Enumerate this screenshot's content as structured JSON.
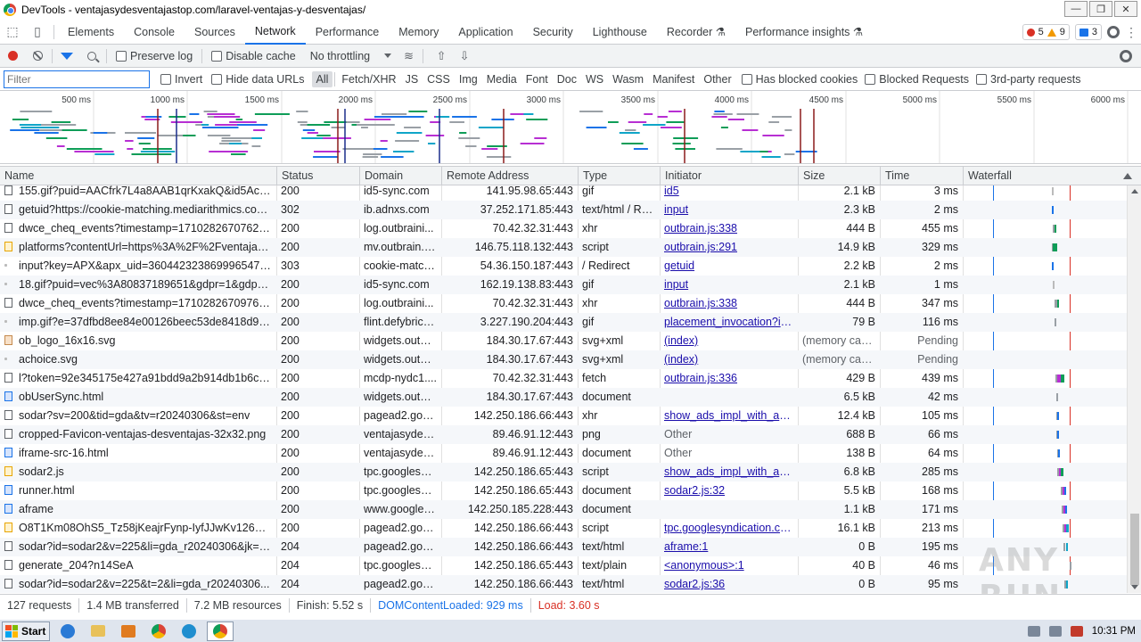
{
  "window": {
    "title": "DevTools - ventajasydesventajastop.com/laravel-ventajas-y-desventajas/",
    "buttons": [
      "—",
      "❐",
      "✕"
    ]
  },
  "devtools": {
    "tabs": [
      "Elements",
      "Console",
      "Sources",
      "Network",
      "Performance",
      "Memory",
      "Application",
      "Security",
      "Lighthouse",
      "Recorder",
      "Performance insights"
    ],
    "active_tab": "Network",
    "errors": "5",
    "warnings": "9",
    "messages": "3"
  },
  "toolbar": {
    "preserve_log": "Preserve log",
    "disable_cache": "Disable cache",
    "throttling": "No throttling"
  },
  "filter": {
    "placeholder": "Filter",
    "invert": "Invert",
    "hide_data_urls": "Hide data URLs",
    "types": [
      "All",
      "Fetch/XHR",
      "JS",
      "CSS",
      "Img",
      "Media",
      "Font",
      "Doc",
      "WS",
      "Wasm",
      "Manifest",
      "Other"
    ],
    "active_type": "All",
    "has_blocked_cookies": "Has blocked cookies",
    "blocked_requests": "Blocked Requests",
    "third_party": "3rd-party requests"
  },
  "overview": {
    "ticks": [
      "500 ms",
      "1000 ms",
      "1500 ms",
      "2000 ms",
      "2500 ms",
      "3000 ms",
      "3500 ms",
      "4000 ms",
      "4500 ms",
      "5000 ms",
      "5500 ms",
      "6000 ms"
    ]
  },
  "table": {
    "columns": [
      "Name",
      "Status",
      "Domain",
      "Remote Address",
      "Type",
      "Initiator",
      "Size",
      "Time",
      "Waterfall"
    ],
    "rows": [
      {
        "icon": "xhr",
        "name": "155.gif?puid=AACfrk7L4a8AAB1qrKxakQ&id5Acco...",
        "status": "200",
        "domain": "id5-sync.com",
        "remote": "141.95.98.65:443",
        "type": "gif",
        "initiator": "id5",
        "initiator_link": true,
        "size": "2.1 kB",
        "time": "3 ms",
        "wf": [
          {
            "s": 0.905,
            "w": 0.004,
            "c": "#bbb"
          }
        ]
      },
      {
        "icon": "xhr",
        "name": "getuid?https://cookie-matching.mediarithmics.com...",
        "status": "302",
        "domain": "ib.adnxs.com",
        "remote": "37.252.171.85:443",
        "type": "text/html / Re...",
        "initiator": "input",
        "initiator_link": true,
        "size": "2.3 kB",
        "time": "2 ms",
        "wf": [
          {
            "s": 0.91,
            "w": 0.006,
            "c": "#1a73e8"
          }
        ]
      },
      {
        "icon": "xhr",
        "name": "dwce_cheq_events?timestamp=1710282670762&s...",
        "status": "200",
        "domain": "log.outbraini...",
        "remote": "70.42.32.31:443",
        "type": "xhr",
        "initiator": "outbrain.js:338",
        "initiator_link": true,
        "size": "444 B",
        "time": "455 ms",
        "wf": [
          {
            "s": 0.915,
            "w": 0.02,
            "c": "#9aa0a6"
          },
          {
            "s": 0.935,
            "w": 0.02,
            "c": "#0f9d58"
          }
        ]
      },
      {
        "icon": "script",
        "name": "platforms?contentUrl=https%3A%2F%2Fventajasy...",
        "status": "200",
        "domain": "mv.outbrain.c...",
        "remote": "146.75.118.132:443",
        "type": "script",
        "initiator": "outbrain.js:291",
        "initiator_link": true,
        "size": "14.9 kB",
        "time": "329 ms",
        "wf": [
          {
            "s": 0.912,
            "w": 0.006,
            "c": "#9aa0a6"
          },
          {
            "s": 0.918,
            "w": 0.045,
            "c": "#0f9d58"
          }
        ]
      },
      {
        "icon": "blank",
        "name": "input?key=APX&apx_uid=3604423238699965471...",
        "status": "303",
        "domain": "cookie-match...",
        "remote": "54.36.150.187:443",
        "type": "/ Redirect",
        "initiator": "getuid",
        "initiator_link": true,
        "size": "2.2 kB",
        "time": "2 ms",
        "wf": [
          {
            "s": 0.913,
            "w": 0.006,
            "c": "#1a73e8"
          }
        ]
      },
      {
        "icon": "blank",
        "name": "18.gif?puid=vec%3A80837189651&gdpr=1&gdpr_...",
        "status": "200",
        "domain": "id5-sync.com",
        "remote": "162.19.138.83:443",
        "type": "gif",
        "initiator": "input",
        "initiator_link": true,
        "size": "2.1 kB",
        "time": "1 ms",
        "wf": [
          {
            "s": 0.915,
            "w": 0.004,
            "c": "#bbb"
          }
        ]
      },
      {
        "icon": "xhr",
        "name": "dwce_cheq_events?timestamp=1710282670976&s...",
        "status": "200",
        "domain": "log.outbraini...",
        "remote": "70.42.32.31:443",
        "type": "xhr",
        "initiator": "outbrain.js:338",
        "initiator_link": true,
        "size": "444 B",
        "time": "347 ms",
        "wf": [
          {
            "s": 0.935,
            "w": 0.03,
            "c": "#9aa0a6"
          },
          {
            "s": 0.965,
            "w": 0.02,
            "c": "#0f9d58"
          }
        ]
      },
      {
        "icon": "blank",
        "name": "imp.gif?e=37dfbd8ee84e00126beec53de8418d9c9...",
        "status": "200",
        "domain": "flint.defybrick...",
        "remote": "3.227.190.204:443",
        "type": "gif",
        "initiator": "placement_invocation?id...",
        "initiator_link": true,
        "size": "79 B",
        "time": "116 ms",
        "wf": [
          {
            "s": 0.935,
            "w": 0.02,
            "c": "#9aa0a6"
          }
        ]
      },
      {
        "icon": "img",
        "name": "ob_logo_16x16.svg",
        "status": "200",
        "domain": "widgets.outbr...",
        "remote": "184.30.17.67:443",
        "type": "svg+xml",
        "initiator": "(index)",
        "initiator_link": true,
        "size": "(memory cac...",
        "time": "Pending",
        "muted": true,
        "wf": []
      },
      {
        "icon": "blank",
        "name": "achoice.svg",
        "status": "200",
        "domain": "widgets.outbr...",
        "remote": "184.30.17.67:443",
        "type": "svg+xml",
        "initiator": "(index)",
        "initiator_link": true,
        "size": "(memory cac...",
        "time": "Pending",
        "muted": true,
        "wf": []
      },
      {
        "icon": "xhr",
        "name": "l?token=92e345175e427a91bdd9a2b914db1b6c_5...",
        "status": "200",
        "domain": "mcdp-nydc1....",
        "remote": "70.42.32.31:443",
        "type": "fetch",
        "initiator": "outbrain.js:336",
        "initiator_link": true,
        "size": "429 B",
        "time": "439 ms",
        "wf": [
          {
            "s": 0.945,
            "w": 0.02,
            "c": "#9aa0a6"
          },
          {
            "s": 0.965,
            "w": 0.035,
            "c": "#b72fd3"
          },
          {
            "s": 1.0,
            "w": 0.04,
            "c": "#0f9d58"
          }
        ]
      },
      {
        "icon": "doc",
        "name": "obUserSync.html",
        "status": "200",
        "domain": "widgets.outbr...",
        "remote": "184.30.17.67:443",
        "type": "document",
        "initiator": "",
        "initiator_link": false,
        "size": "6.5 kB",
        "time": "42 ms",
        "wf": [
          {
            "s": 0.95,
            "w": 0.01,
            "c": "#9aa0a6"
          }
        ]
      },
      {
        "icon": "xhr",
        "name": "sodar?sv=200&tid=gda&tv=r20240306&st=env",
        "status": "200",
        "domain": "pagead2.goo...",
        "remote": "142.250.186.66:443",
        "type": "xhr",
        "initiator": "show_ads_impl_with_ama...",
        "initiator_link": true,
        "size": "12.4 kB",
        "time": "105 ms",
        "wf": [
          {
            "s": 0.955,
            "w": 0.01,
            "c": "#9aa0a6"
          },
          {
            "s": 0.965,
            "w": 0.015,
            "c": "#1a73e8"
          }
        ]
      },
      {
        "icon": "xhr",
        "name": "cropped-Favicon-ventajas-desventajas-32x32.png",
        "status": "200",
        "domain": "ventajasydesv...",
        "remote": "89.46.91.12:443",
        "type": "png",
        "initiator": "Other",
        "initiator_link": false,
        "muted_initiator": true,
        "size": "688 B",
        "time": "66 ms",
        "wf": [
          {
            "s": 0.955,
            "w": 0.01,
            "c": "#9aa0a6"
          },
          {
            "s": 0.965,
            "w": 0.01,
            "c": "#1a73e8"
          }
        ]
      },
      {
        "icon": "doc",
        "name": "iframe-src-16.html",
        "status": "200",
        "domain": "ventajasydesv...",
        "remote": "89.46.91.12:443",
        "type": "document",
        "initiator": "Other",
        "initiator_link": false,
        "muted_initiator": true,
        "size": "138 B",
        "time": "64 ms",
        "wf": [
          {
            "s": 0.96,
            "w": 0.01,
            "c": "#9aa0a6"
          },
          {
            "s": 0.97,
            "w": 0.01,
            "c": "#1a73e8"
          }
        ]
      },
      {
        "icon": "script",
        "name": "sodar2.js",
        "status": "200",
        "domain": "tpc.googlesyn...",
        "remote": "142.250.186.65:443",
        "type": "script",
        "initiator": "show_ads_impl_with_ama...",
        "initiator_link": true,
        "size": "6.8 kB",
        "time": "285 ms",
        "wf": [
          {
            "s": 0.96,
            "w": 0.02,
            "c": "#9aa0a6"
          },
          {
            "s": 0.98,
            "w": 0.02,
            "c": "#b72fd3"
          },
          {
            "s": 1.0,
            "w": 0.03,
            "c": "#0f9d58"
          }
        ]
      },
      {
        "icon": "doc",
        "name": "runner.html",
        "status": "200",
        "domain": "tpc.googlesyn...",
        "remote": "142.250.186.65:443",
        "type": "document",
        "initiator": "sodar2.js:32",
        "initiator_link": true,
        "size": "5.5 kB",
        "time": "168 ms",
        "wf": [
          {
            "s": 1.0,
            "w": 0.015,
            "c": "#9aa0a6"
          },
          {
            "s": 1.015,
            "w": 0.02,
            "c": "#b72fd3"
          },
          {
            "s": 1.035,
            "w": 0.015,
            "c": "#1a73e8"
          }
        ]
      },
      {
        "icon": "doc",
        "name": "aframe",
        "status": "200",
        "domain": "www.google.c...",
        "remote": "142.250.185.228:443",
        "type": "document",
        "initiator": "",
        "initiator_link": false,
        "size": "1.1 kB",
        "time": "171 ms",
        "wf": [
          {
            "s": 1.01,
            "w": 0.02,
            "c": "#9aa0a6"
          },
          {
            "s": 1.03,
            "w": 0.015,
            "c": "#b72fd3"
          },
          {
            "s": 1.045,
            "w": 0.01,
            "c": "#1a73e8"
          }
        ]
      },
      {
        "icon": "script",
        "name": "O8T1Km08OhS5_Tz58jKeajrFynp-IyfJJwKv1268Sc.js",
        "status": "200",
        "domain": "pagead2.goo...",
        "remote": "142.250.186.66:443",
        "type": "script",
        "initiator": "tpc.googlesyndication.co...",
        "initiator_link": true,
        "size": "16.1 kB",
        "time": "213 ms",
        "wf": [
          {
            "s": 1.02,
            "w": 0.02,
            "c": "#9aa0a6"
          },
          {
            "s": 1.04,
            "w": 0.015,
            "c": "#b72fd3"
          },
          {
            "s": 1.055,
            "w": 0.025,
            "c": "#0fa5c8"
          }
        ]
      },
      {
        "icon": "xhr",
        "name": "sodar?id=sodar2&v=225&li=gda_r20240306&jk=2...",
        "status": "204",
        "domain": "pagead2.goo...",
        "remote": "142.250.186.66:443",
        "type": "text/html",
        "initiator": "aframe:1",
        "initiator_link": true,
        "size": "0 B",
        "time": "195 ms",
        "wf": [
          {
            "s": 1.03,
            "w": 0.02,
            "c": "#9aa0a6"
          },
          {
            "s": 1.05,
            "w": 0.02,
            "c": "#0fa5c8"
          }
        ]
      },
      {
        "icon": "xhr",
        "name": "generate_204?n14SeA",
        "status": "204",
        "domain": "tpc.googlesyn...",
        "remote": "142.250.186.65:443",
        "type": "text/plain",
        "initiator": "<anonymous>:1",
        "initiator_link": true,
        "size": "40 B",
        "time": "46 ms",
        "wf": [
          {
            "s": 1.09,
            "w": 0.012,
            "c": "#9aa0a6"
          }
        ]
      },
      {
        "icon": "xhr",
        "name": "sodar?id=sodar2&v=225&t=2&li=gda_r20240306...",
        "status": "204",
        "domain": "pagead2.goo...",
        "remote": "142.250.186.66:443",
        "type": "text/html",
        "initiator": "sodar2.js:36",
        "initiator_link": true,
        "size": "0 B",
        "time": "95 ms",
        "wf": [
          {
            "s": 1.04,
            "w": 0.012,
            "c": "#9aa0a6"
          },
          {
            "s": 1.052,
            "w": 0.012,
            "c": "#0fa5c8"
          }
        ]
      }
    ]
  },
  "status": {
    "requests": "127 requests",
    "transferred": "1.4 MB transferred",
    "resources": "7.2 MB resources",
    "finish": "Finish: 5.52 s",
    "domcontentloaded": "DOMContentLoaded: 929 ms",
    "load": "Load: 3.60 s"
  },
  "taskbar": {
    "start": "Start",
    "clock": "10:31 PM"
  },
  "watermark": "ANY RUN",
  "colors": {
    "accent": "#1a73e8",
    "error": "#d93025",
    "warning": "#f29900",
    "link": "#1a0dab"
  }
}
